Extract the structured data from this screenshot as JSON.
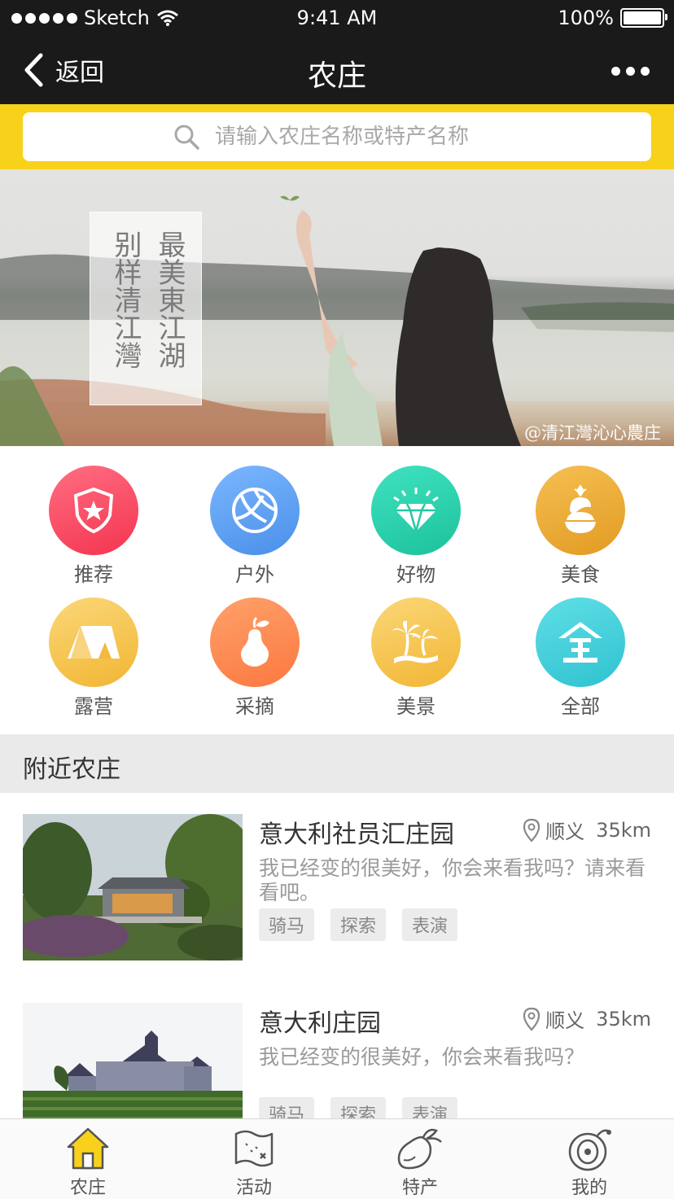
{
  "status": {
    "carrier": "Sketch",
    "time": "9:41 AM",
    "battery": "100%"
  },
  "nav": {
    "back_label": "返回",
    "title": "农庄"
  },
  "search": {
    "placeholder": "请输入农庄名称或特产名称"
  },
  "banner": {
    "poem_col1": "最美東江湖",
    "poem_col2": "别样清江灣",
    "watermark": "@清江灣沁心農庄"
  },
  "categories": [
    {
      "label": "推荐",
      "icon": "shield-star-icon",
      "color": "#fb4a66"
    },
    {
      "label": "户外",
      "icon": "volleyball-icon",
      "color": "#5b9ff0"
    },
    {
      "label": "好物",
      "icon": "diamond-icon",
      "color": "#22c9a4"
    },
    {
      "label": "美食",
      "icon": "dessert-icon",
      "color": "#e9a52b"
    },
    {
      "label": "露营",
      "icon": "tent-icon",
      "color": "#f7c24a"
    },
    {
      "label": "采摘",
      "icon": "pear-icon",
      "color": "#fd8a52"
    },
    {
      "label": "美景",
      "icon": "palm-tree-icon",
      "color": "#f7c24a"
    },
    {
      "label": "全部",
      "icon": "all-icon",
      "color": "#3ccbd6"
    }
  ],
  "section": {
    "title": "附近农庄"
  },
  "farms": [
    {
      "name": "意大利社员汇庄园",
      "location": "顺义",
      "distance": "35km",
      "desc": "我已经变的很美好，你会来看我吗？请来看看吧。",
      "tags": [
        "骑马",
        "探索",
        "表演"
      ]
    },
    {
      "name": "意大利庄园",
      "location": "顺义",
      "distance": "35km",
      "desc": "我已经变的很美好，你会来看我吗？",
      "tags": [
        "骑马",
        "探索",
        "表演"
      ]
    }
  ],
  "tabs": [
    {
      "label": "农庄",
      "icon": "farmhouse-icon",
      "active": true
    },
    {
      "label": "活动",
      "icon": "map-icon",
      "active": false
    },
    {
      "label": "特产",
      "icon": "fruit-icon",
      "active": false
    },
    {
      "label": "我的",
      "icon": "profile-icon",
      "active": false
    }
  ],
  "colors": {
    "accent": "#f8d21a",
    "nav_bg": "#1a1a1a"
  }
}
